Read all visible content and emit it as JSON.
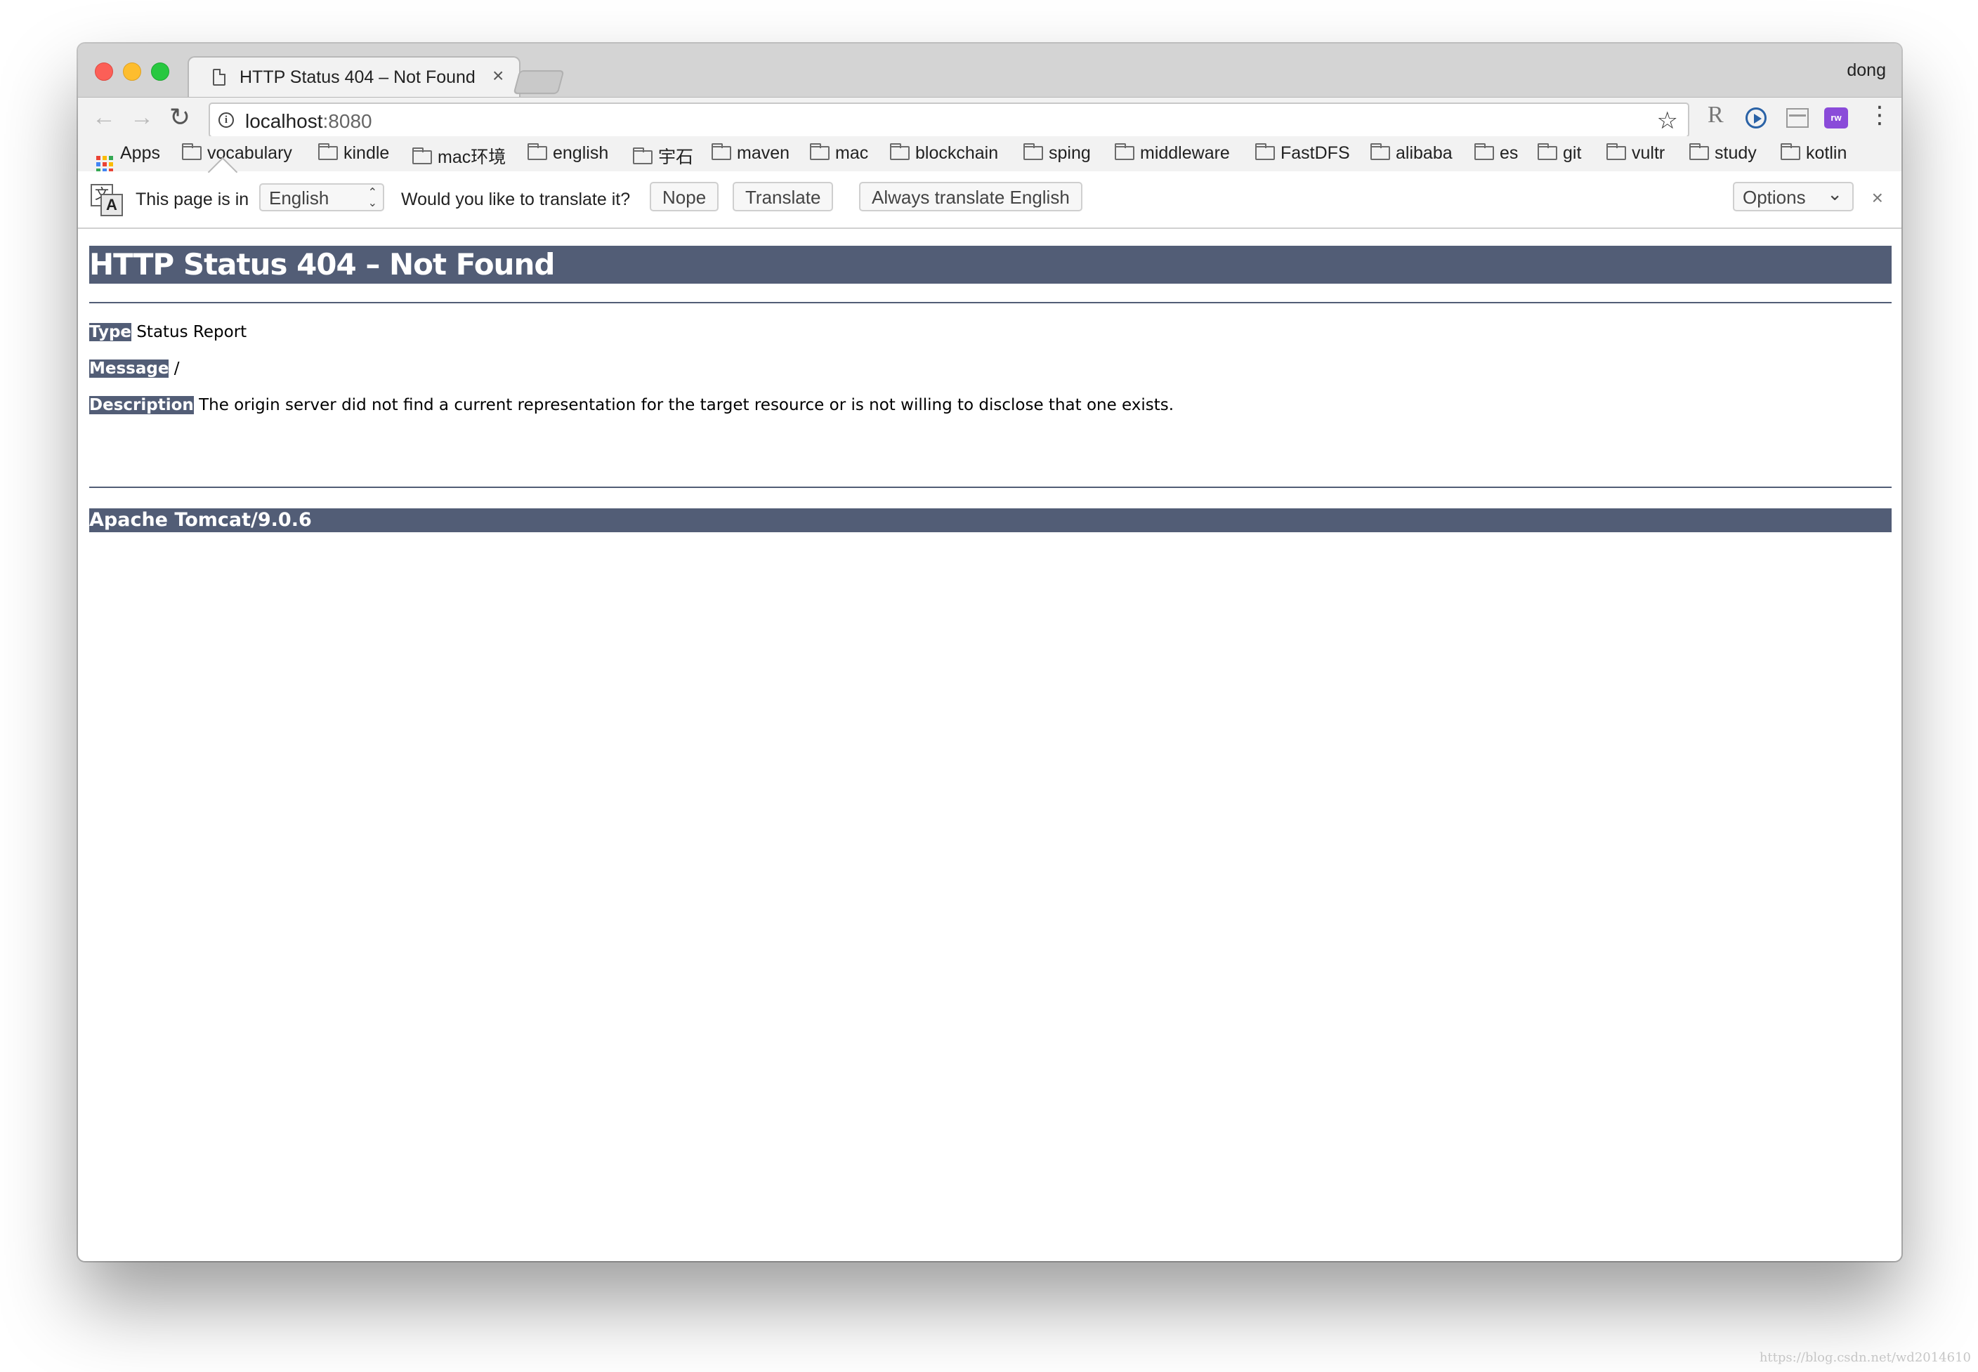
{
  "browser": {
    "tab_title": "HTTP Status 404 – Not Found",
    "tab_close": "×",
    "profile_name": "dong",
    "url_host": "localhost",
    "url_port": ":8080",
    "info_icon": "i",
    "extension_r": "R",
    "extension_rw": "rw",
    "menu_glyph": "⋮",
    "star_glyph": "☆",
    "back_glyph": "←",
    "forward_glyph": "→",
    "reload_glyph": "↻"
  },
  "bookmarks": [
    {
      "label": "Apps"
    },
    {
      "label": "vocabulary"
    },
    {
      "label": "kindle"
    },
    {
      "label": "mac环境"
    },
    {
      "label": "english"
    },
    {
      "label": "宇石"
    },
    {
      "label": "maven"
    },
    {
      "label": "mac"
    },
    {
      "label": "blockchain"
    },
    {
      "label": "sping"
    },
    {
      "label": "middleware"
    },
    {
      "label": "FastDFS"
    },
    {
      "label": "alibaba"
    },
    {
      "label": "es"
    },
    {
      "label": "git"
    },
    {
      "label": "vultr"
    },
    {
      "label": "study"
    },
    {
      "label": "kotlin"
    }
  ],
  "translate_bar": {
    "icon_cn": "文",
    "icon_a": "A",
    "prefix": "This page is in",
    "language": "English",
    "question": "Would you like to translate it?",
    "nope": "Nope",
    "translate": "Translate",
    "always": "Always translate English",
    "options": "Options",
    "options_chevron": "⌄",
    "close": "×"
  },
  "page": {
    "heading": "HTTP Status 404 – Not Found",
    "type_label": "Type",
    "type_value": " Status Report",
    "message_label": "Message",
    "message_value": " /",
    "description_label": "Description",
    "description_value": " The origin server did not find a current representation for the target resource or is not willing to disclose that one exists.",
    "footer": "Apache Tomcat/9.0.6"
  },
  "watermark": "https://blog.csdn.net/wd2014610",
  "colors": {
    "tomcat_header": "#525d76",
    "apps_grid": [
      "#ea4335",
      "#fbbc05",
      "#34a853",
      "#4285f4",
      "#ea4335",
      "#fbbc05",
      "#34a853",
      "#4285f4",
      "#ea4335"
    ]
  }
}
